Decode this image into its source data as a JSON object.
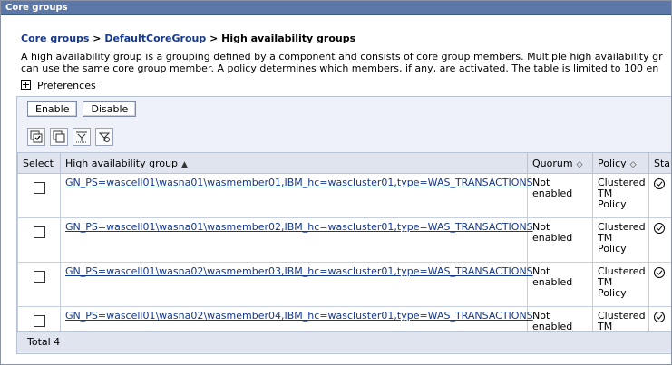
{
  "header": {
    "title": "Core groups"
  },
  "breadcrumb": {
    "link1": "Core groups",
    "sep1": " > ",
    "link2": "DefaultCoreGroup",
    "sep2": " > ",
    "current": "High availability groups"
  },
  "description": {
    "line1": "A high availability group is a grouping defined by a component and consists of core group members. Multiple high availability gr",
    "line2": "can use the same core group member. A policy determines which members, if any, are activated. The table is limited to 100 en"
  },
  "preferences": {
    "label": "Preferences"
  },
  "buttons": {
    "enable": "Enable",
    "disable": "Disable"
  },
  "toolbar_icons": [
    "select-all-icon",
    "deselect-all-icon",
    "show-filter-icon",
    "clear-filter-icon"
  ],
  "table": {
    "columns": [
      "Select",
      "High availability group",
      "Quorum",
      "Policy",
      "Sta"
    ],
    "rows": [
      {
        "group": "GN_PS=wascell01\\wasna01\\wasmember01,IBM_hc=wascluster01,type=WAS_TRANSACTIONS",
        "quorum_1": "Not",
        "quorum_2": "enabled",
        "policy_1": "Clustered",
        "policy_2": "TM Policy"
      },
      {
        "group": "GN_PS=wascell01\\wasna01\\wasmember02,IBM_hc=wascluster01,type=WAS_TRANSACTIONS",
        "quorum_1": "Not",
        "quorum_2": "enabled",
        "policy_1": "Clustered",
        "policy_2": "TM Policy"
      },
      {
        "group": "GN_PS=wascell01\\wasna02\\wasmember03,IBM_hc=wascluster01,type=WAS_TRANSACTIONS",
        "quorum_1": "Not",
        "quorum_2": "enabled",
        "policy_1": "Clustered",
        "policy_2": "TM Policy"
      },
      {
        "group": "GN_PS=wascell01\\wasna02\\wasmember04,IBM_hc=wascluster01,type=WAS_TRANSACTIONS",
        "quorum_1": "Not",
        "quorum_2": "enabled",
        "policy_1": "Clustered",
        "policy_2": "TM Policy"
      }
    ],
    "total": "Total 4"
  }
}
